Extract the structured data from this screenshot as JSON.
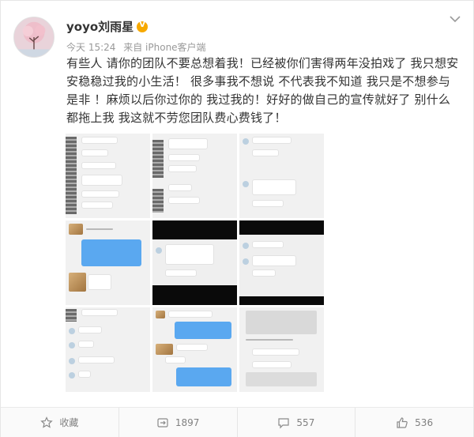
{
  "post": {
    "username": "yoyo刘雨星",
    "verified_icon": "vip-badge-icon",
    "time": "今天 15:24",
    "source": "来自 iPhone客户端",
    "text": "有些人 请你的团队不要总想着我！已经被你们害得两年没拍戏了 我只想安安稳稳过我的小生活！ 很多事我不想说 不代表我不知道 我只是不想参与是非 ！麻烦以后你过你的 我过我的！好好的做自己的宣传就好了 别什么都拖上我 我这就不劳您团队费心费钱了！"
  },
  "images": {
    "count": 9
  },
  "actions": {
    "favorite_label": "收藏",
    "repost_count": "1897",
    "comment_count": "557",
    "like_count": "536"
  },
  "colors": {
    "text": "#333333",
    "meta": "#999999",
    "vip": "#f7a900",
    "bubble_blue": "#5aa8f0"
  }
}
